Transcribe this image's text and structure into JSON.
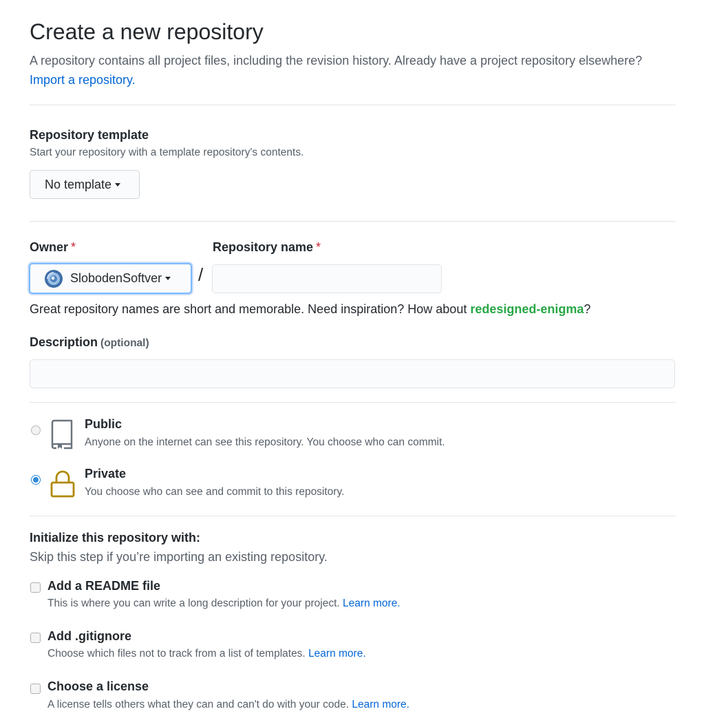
{
  "header": {
    "title": "Create a new repository",
    "subtitle": "A repository contains all project files, including the revision history. Already have a project repository elsewhere?",
    "import_link": "Import a repository."
  },
  "template": {
    "label": "Repository template",
    "note": "Start your repository with a template repository's contents.",
    "button_label": "No template"
  },
  "owner": {
    "label": "Owner",
    "required_mark": "*",
    "value": "SlobodenSoftver"
  },
  "repo_name": {
    "label": "Repository name",
    "required_mark": "*",
    "value": "",
    "separator": "/"
  },
  "suggestion": {
    "text_before": "Great repository names are short and memorable. Need inspiration? How about ",
    "name": "redesigned-enigma",
    "text_after": "?"
  },
  "description": {
    "label": "Description",
    "optional": "(optional)",
    "value": ""
  },
  "visibility": {
    "selected": "private",
    "public": {
      "title": "Public",
      "desc": "Anyone on the internet can see this repository. You choose who can commit.",
      "icon": "repo-icon"
    },
    "private": {
      "title": "Private",
      "desc": "You choose who can see and commit to this repository.",
      "icon": "lock-icon"
    }
  },
  "initialize": {
    "heading": "Initialize this repository with:",
    "note": "Skip this step if you’re importing an existing repository.",
    "options": [
      {
        "title": "Add a README file",
        "desc": "This is where you can write a long description for your project.",
        "link": "Learn more.",
        "checked": false
      },
      {
        "title": "Add .gitignore",
        "desc": "Choose which files not to track from a list of templates.",
        "link": "Learn more.",
        "checked": false
      },
      {
        "title": "Choose a license",
        "desc": "A license tells others what they can and can't do with your code.",
        "link": "Learn more.",
        "checked": false
      }
    ]
  },
  "colors": {
    "link": "#0366d6",
    "suggestion": "#28a745",
    "required": "#cb2431",
    "lock_icon": "#b08800",
    "radio_selected": "#2f8ad8"
  }
}
